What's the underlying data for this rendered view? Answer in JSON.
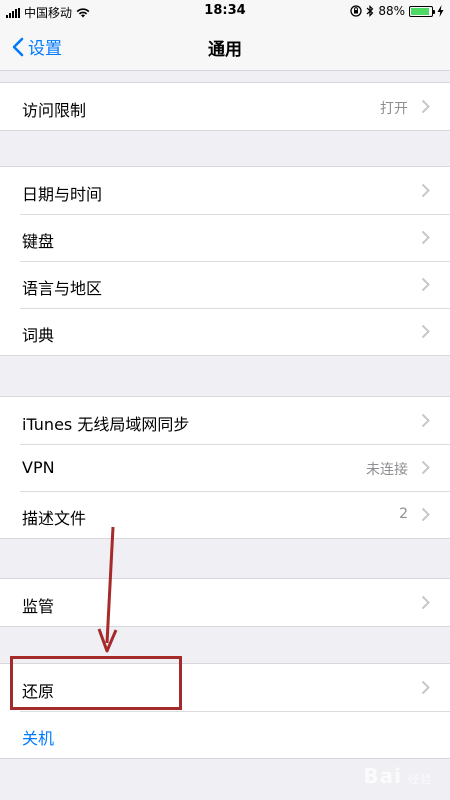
{
  "status_bar": {
    "carrier": "中国移动",
    "time": "18:34",
    "battery": "88%",
    "battery_level": 0.88
  },
  "nav": {
    "back_label": "设置",
    "title": "通用"
  },
  "sections": [
    [
      {
        "label": "访问限制",
        "value": "打开"
      }
    ],
    [
      {
        "label": "日期与时间",
        "value": ""
      },
      {
        "label": "键盘",
        "value": ""
      },
      {
        "label": "语言与地区",
        "value": ""
      },
      {
        "label": "词典",
        "value": ""
      }
    ],
    [
      {
        "label": "iTunes 无线局域网同步",
        "value": ""
      },
      {
        "label": "VPN",
        "value": "未连接"
      },
      {
        "label": "描述文件",
        "value": "2"
      }
    ],
    [
      {
        "label": "监管",
        "value": ""
      }
    ],
    [
      {
        "label": "还原",
        "value": ""
      },
      {
        "label": "关机",
        "value": ""
      }
    ]
  ],
  "icons": {
    "back": "chevron-left-icon",
    "row": "chevron-right-icon",
    "wifi": "wifi-icon",
    "bluetooth": "bluetooth-icon",
    "lock": "orientation-lock-icon",
    "battery": "battery-icon",
    "charging": "charging-bolt-icon"
  },
  "colors": {
    "accent": "#007aff",
    "highlight": "#a52a2a",
    "battery": "#4cd964"
  },
  "watermark": {
    "brand": "Bai",
    "sub": "经验"
  }
}
